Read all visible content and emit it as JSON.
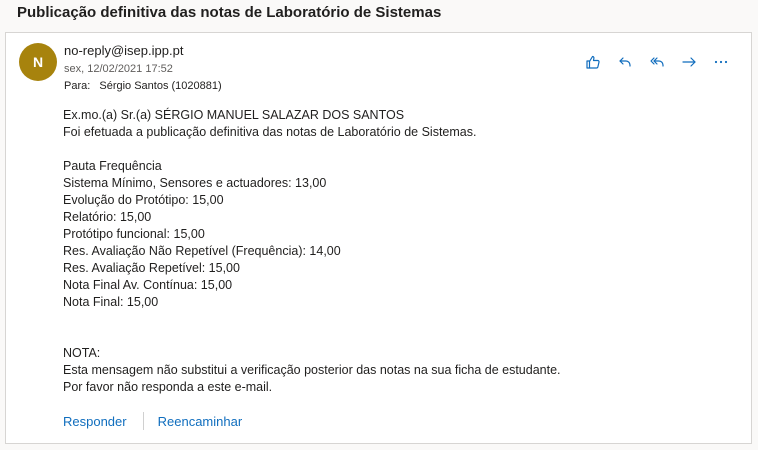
{
  "email": {
    "subject": "Publicação definitiva das notas de Laboratório de Sistemas",
    "avatar_initial": "N",
    "sender": "no-reply@isep.ipp.pt",
    "date": "sex, 12/02/2021 17:52",
    "to_label": "Para:",
    "to_value": "Sérgio Santos (1020881)"
  },
  "actions": {
    "like_icon": "thumbs-up-icon",
    "reply_icon": "reply-icon",
    "reply_all_icon": "reply-all-icon",
    "forward_icon": "forward-icon",
    "more_icon": "more-icon",
    "accent": "#0f6cbd"
  },
  "body": {
    "greeting": "Ex.mo.(a) Sr.(a) SÉRGIO MANUEL SALAZAR DOS SANTOS",
    "intro": "Foi efetuada a publicação definitiva das notas de Laboratório de Sistemas.",
    "grades_title": "Pauta Frequência",
    "grades": [
      "Sistema Mínimo, Sensores e actuadores: 13,00",
      "Evolução do Protótipo: 15,00",
      "Relatório: 15,00",
      "Protótipo funcional: 15,00",
      "Res. Avaliação Não Repetível (Frequência): 14,00",
      "Res. Avaliação Repetível: 15,00",
      "Nota Final Av. Contínua: 15,00",
      "Nota Final: 15,00"
    ],
    "note_title": "NOTA:",
    "note_line1": "Esta mensagem não substitui a verificação posterior das notas na sua ficha de estudante.",
    "note_line2": "Por favor não responda a este e-mail."
  },
  "footer": {
    "reply_label": "Responder",
    "forward_label": "Reencaminhar"
  }
}
